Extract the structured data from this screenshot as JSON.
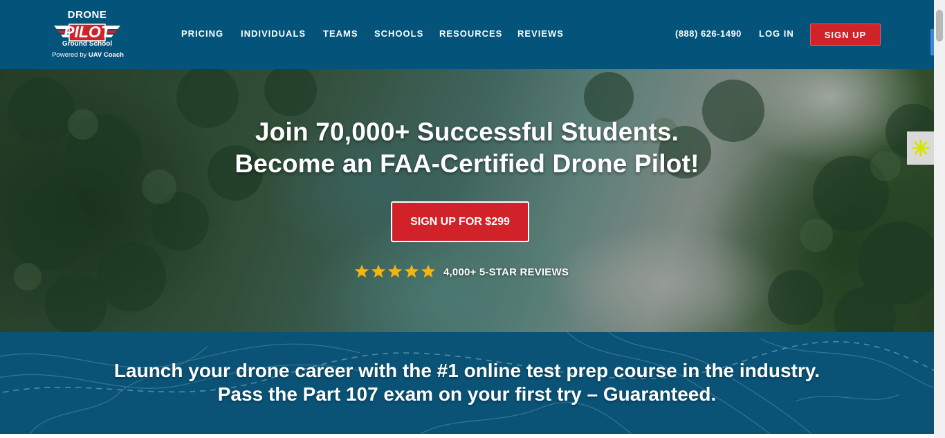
{
  "logo": {
    "line1": "DRONE",
    "line2": "PILOT",
    "line3": "Ground School",
    "powered_prefix": "Powered by",
    "powered_brand": "UAV Coach"
  },
  "nav": {
    "items": [
      {
        "label": "PRICING"
      },
      {
        "label": "INDIVIDUALS"
      },
      {
        "label": "TEAMS"
      },
      {
        "label": "SCHOOLS"
      },
      {
        "label": "RESOURCES"
      },
      {
        "label": "REVIEWS"
      }
    ],
    "phone": "(888) 626-1490",
    "login": "LOG IN",
    "signup": "SIGN UP"
  },
  "hero": {
    "headline_line1": "Join 70,000+ Successful Students.",
    "headline_line2": "Become an FAA-Certified Drone Pilot!",
    "cta": "SIGN UP FOR $299",
    "rating_stars": 5,
    "reviews": "4,000+ 5-STAR REVIEWS"
  },
  "band": {
    "line1": "Launch your drone career with the #1 online test prep course in the industry.",
    "line2": "Pass the Part 107 exam on your first try – Guaranteed."
  },
  "colors": {
    "header_bg": "#03537a",
    "accent_red": "#d12229",
    "star": "#f5b50a",
    "band_bg": "#0a5376"
  },
  "icons": {
    "feedback": "asterisk-icon",
    "rating": "star-icon"
  }
}
